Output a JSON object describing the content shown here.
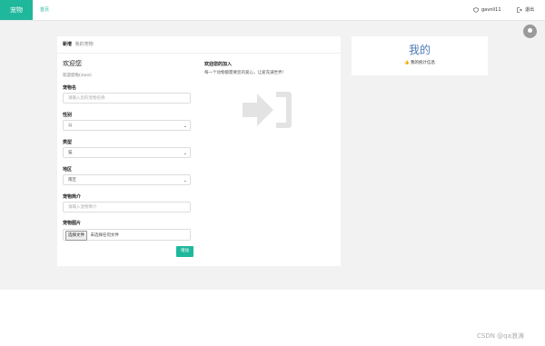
{
  "topbar": {
    "brand": "宠物",
    "home": "首页",
    "username": "gavnli11",
    "logout": "退出"
  },
  "card": {
    "title": "新增",
    "subtitle": "我的宠物"
  },
  "form": {
    "welcome": "欢迎您",
    "welcome_sub": "欢迎您啦(⊙o⊙)",
    "name_label": "宠物名",
    "name_placeholder": "请输入您的宠物名称",
    "gender_label": "性别",
    "gender_value": "公",
    "type_label": "类型",
    "type_value": "猫",
    "area_label": "地区",
    "area_value": "南区",
    "intro_label": "宠物简介",
    "intro_placeholder": "请输入宠物简介",
    "photo_label": "宠物图片",
    "file_button": "选择文件",
    "file_status": "未选择任何文件",
    "submit": "增加"
  },
  "info": {
    "title": "欢迎您的加入",
    "text": "每一个动物都需要您的爱心，让爱充满世界！"
  },
  "side": {
    "title": "我的",
    "link": "我的统计信息"
  },
  "watermark": "CSDN @qa浪涛"
}
